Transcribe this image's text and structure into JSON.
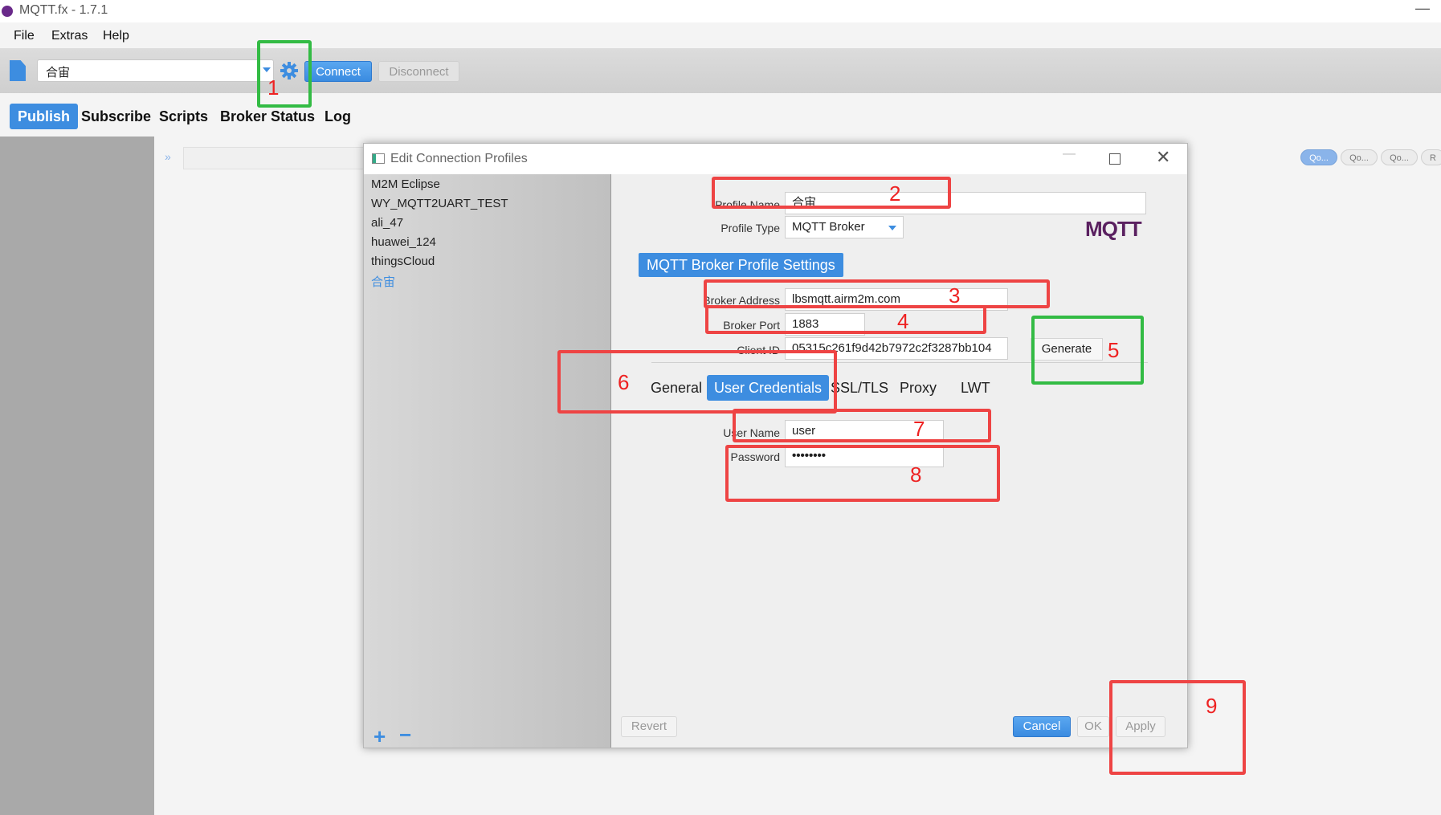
{
  "window": {
    "title": "MQTT.fx - 1.7.1",
    "minimize_glyph": "—"
  },
  "menu": {
    "items": [
      "File",
      "Extras",
      "Help"
    ]
  },
  "toolbar": {
    "profile_value": "合宙",
    "connect_label": "Connect",
    "disconnect_label": "Disconnect",
    "gear_icon": "gear-icon",
    "doc_icon": "document-icon"
  },
  "tabs": [
    "Publish",
    "Subscribe",
    "Scripts",
    "Broker Status",
    "Log"
  ],
  "publish": {
    "collapse_glyph": "»",
    "qos": [
      "Qo...",
      "Qo...",
      "Qo...",
      "R"
    ]
  },
  "dialog": {
    "title": "Edit Connection Profiles",
    "profiles": [
      "M2M Eclipse",
      "WY_MQTT2UART_TEST",
      "ali_47",
      "huawei_124",
      "thingsCloud",
      "合宙"
    ],
    "add_glyph": "+",
    "remove_glyph": "−",
    "profile_name_label": "Profile Name",
    "profile_name_value": "合宙",
    "profile_type_label": "Profile Type",
    "profile_type_value": "MQTT Broker",
    "logo_text": "MQTT",
    "section_title": "MQTT Broker Profile Settings",
    "broker_address_label": "Broker Address",
    "broker_address_value": "lbsmqtt.airm2m.com",
    "broker_port_label": "Broker Port",
    "broker_port_value": "1883",
    "client_id_label": "Client ID",
    "client_id_value": "05315c261f9d42b7972c2f3287bb104",
    "generate_label": "Generate",
    "sub_tabs": [
      "General",
      "User Credentials",
      "SSL/TLS",
      "Proxy",
      "LWT"
    ],
    "user_name_label": "User Name",
    "user_name_value": "user",
    "password_label": "Password",
    "password_value": "••••••••",
    "revert_label": "Revert",
    "cancel_label": "Cancel",
    "ok_label": "OK",
    "apply_label": "Apply"
  },
  "annotations": [
    "1",
    "2",
    "3",
    "4",
    "5",
    "6",
    "7",
    "8",
    "9"
  ],
  "colors": {
    "accent": "#3d8de0",
    "annotation_red": "#ee4444",
    "annotation_green": "#33bb44"
  }
}
